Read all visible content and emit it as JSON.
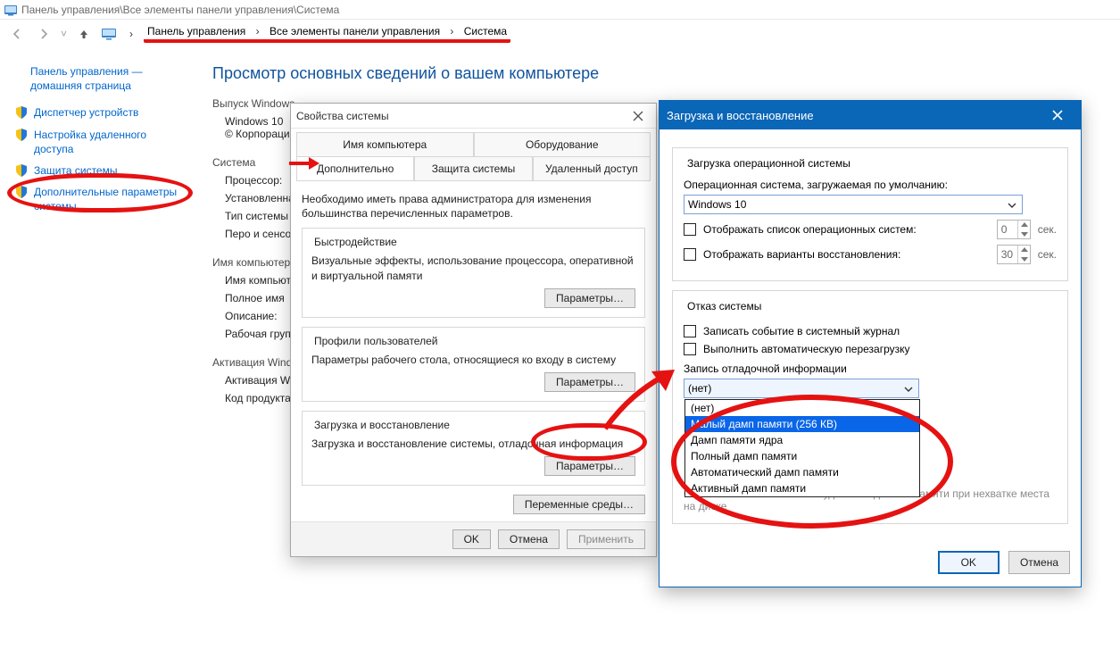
{
  "titlebar": "Панель управления\\Все элементы панели управления\\Система",
  "crumbs": {
    "a": "Панель управления",
    "b": "Все элементы панели управления",
    "c": "Система",
    "sep": "›"
  },
  "sidebar": {
    "home_line1": "Панель управления —",
    "home_line2": "домашняя страница",
    "items": [
      "Диспетчер устройств",
      "Настройка удаленного доступа",
      "Защита системы",
      "Дополнительные параметры системы"
    ]
  },
  "main": {
    "page_title": "Просмотр основных сведений о вашем компьютере",
    "editions_heading": "Выпуск Windows",
    "edition_name": "Windows 10",
    "copyright": "© Корпорация",
    "system_heading": "Система",
    "rows": {
      "cpu": "Процессор:",
      "ram": "Установленная (ОЗУ):",
      "type": "Тип системы",
      "pen": "Перо и сенсо",
      "pcname_heading": "Имя компьютера",
      "pcname": "Имя компьютера",
      "fullname": "Полное имя",
      "desc": "Описание:",
      "workgroup": "Рабочая группа",
      "activation_heading": "Активация Windows",
      "activation": "Активация Windows",
      "product": "Код продукта"
    }
  },
  "dialog1": {
    "title": "Свойства системы",
    "tabs": {
      "name": "Имя компьютера",
      "hw": "Оборудование",
      "adv": "Дополнительно",
      "protect": "Защита системы",
      "remote": "Удаленный доступ"
    },
    "note": "Необходимо иметь права администратора для изменения большинства перечисленных параметров.",
    "perf_title": "Быстродействие",
    "perf_desc": "Визуальные эффекты, использование процессора, оперативной и виртуальной памяти",
    "params_btn": "Параметры…",
    "profiles_title": "Профили пользователей",
    "profiles_desc": "Параметры рабочего стола, относящиеся ко входу в систему",
    "startup_title": "Загрузка и восстановление",
    "startup_desc": "Загрузка и восстановление системы, отладочная информация",
    "envvars_btn": "Переменные среды…",
    "ok": "OK",
    "cancel": "Отмена",
    "apply": "Применить"
  },
  "dialog2": {
    "title": "Загрузка и восстановление",
    "grp1_legend": "Загрузка операционной системы",
    "default_os_label": "Операционная система, загружаемая по умолчанию:",
    "default_os_value": "Windows 10",
    "show_list": "Отображать список операционных систем:",
    "show_list_secs": "0",
    "show_recovery": "Отображать варианты восстановления:",
    "show_recovery_secs": "30",
    "sec": "сек.",
    "grp2_legend": "Отказ системы",
    "cb_log": "Записать событие в системный журнал",
    "cb_autoreboot": "Выполнить автоматическую перезагрузку",
    "dump_label": "Запись отладочной информации",
    "dump_value": "(нет)",
    "dump_options": [
      "(нет)",
      "Малый дамп памяти (256 КВ)",
      "Дамп памяти ядра",
      "Полный дамп памяти",
      "Автоматический дамп памяти",
      "Активный дамп памяти"
    ],
    "ghost": "Отключить автоматическое удаление дампов памяти при нехватке места на диске",
    "ok": "OK",
    "cancel": "Отмена"
  }
}
